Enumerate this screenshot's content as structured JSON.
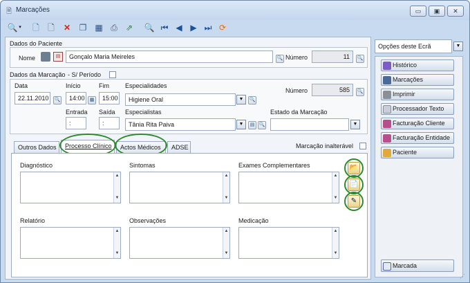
{
  "window": {
    "title": "Marcações",
    "minimize": "▭",
    "maximize": "▣",
    "close": "✕"
  },
  "toolbar": {
    "icons": [
      "search-icon",
      "new-document-icon",
      "document-icon",
      "delete-icon",
      "copy-icon",
      "calendar-icon",
      "print-icon",
      "export-icon",
      "preview-icon",
      "first-record-icon",
      "previous-record-icon",
      "next-record-icon",
      "last-record-icon",
      "refresh-icon"
    ]
  },
  "patient": {
    "section_title": "Dados do Paciente",
    "name_label": "Nome",
    "name_value": "Gonçalo Maria Meireles",
    "number_label": "Número",
    "number_value": "11"
  },
  "appointment": {
    "section_title": "Dados da Marcação",
    "no_period_label": "- S/ Período",
    "date_label": "Data",
    "date_value": "22.11.2010",
    "start_label": "Início",
    "start_value": "14:00",
    "end_label": "Fim",
    "end_value": "15:00",
    "specialties_label": "Especialidades",
    "specialty_value": "Higiene Oral",
    "number_label": "Número",
    "number_value": "585",
    "entry_label": "Entrada",
    "entry_value": ":",
    "exit_label": "Saída",
    "exit_value": ":",
    "specialists_label": "Especialistas",
    "specialist_value": "Tânia Rita Paiva",
    "status_label": "Estado da Marcação",
    "status_value": ""
  },
  "tabs": [
    {
      "label": "Outros Dados"
    },
    {
      "label": "Processo Clínico"
    },
    {
      "label": "Actos Médicos"
    },
    {
      "label": "ADSE"
    }
  ],
  "unalterable_label": "Marcação inalterável",
  "clinical": {
    "diagnostic_label": "Diagnóstico",
    "symptoms_label": "Sintomas",
    "exams_label": "Exames Complementares",
    "report_label": "Relatório",
    "observations_label": "Observações",
    "medication_label": "Medicação"
  },
  "sidebar": {
    "options_value": "Opções deste Ecrã",
    "buttons": [
      {
        "label": "Histórico"
      },
      {
        "label": "Marcações"
      },
      {
        "label": "Imprimir"
      },
      {
        "label": "Processador Texto"
      },
      {
        "label": "Facturação Cliente"
      },
      {
        "label": "Facturação Entidade"
      },
      {
        "label": "Paciente"
      }
    ],
    "status_button": "Marcada"
  },
  "colors": {
    "highlight_circle": "#2d8a2d",
    "window_frame": "#c8daf0"
  }
}
